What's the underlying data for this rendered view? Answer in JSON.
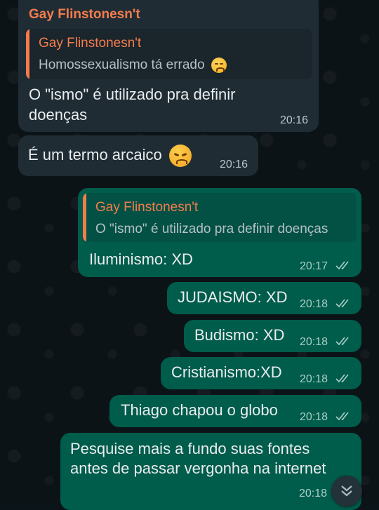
{
  "messages": [
    {
      "sender": "Gay Flinstonesn't",
      "quote": {
        "name": "Gay Flinstonesn't",
        "text": "Homossexualismo tá errado"
      },
      "lines": [
        "O \"ismo\" é utilizado pra definir",
        "doenças"
      ],
      "time": "20:16"
    },
    {
      "text": "É um termo arcaico",
      "time": "20:16"
    },
    {
      "quote": {
        "name": "Gay Flinstonesn't",
        "text": "O \"ismo\" é utilizado pra definir doenças"
      },
      "text": "Iluminismo: XD",
      "time": "20:17"
    },
    {
      "text": "JUDAISMO: XD",
      "time": "20:18"
    },
    {
      "text": "Budismo: XD",
      "time": "20:18"
    },
    {
      "text": "Cristianismo:XD",
      "time": "20:18"
    },
    {
      "text": "Thiago chapou o globo",
      "time": "20:18"
    },
    {
      "lines": [
        "Pesquise mais a fundo suas fontes",
        "antes de passar vergonha na internet"
      ],
      "time": "20:18"
    }
  ],
  "colors": {
    "incoming": "#1f2c34",
    "outgoing": "#005c4b",
    "sender_name": "#f57c4c",
    "read_ticks": "#a9cfc6"
  },
  "icons": {
    "emoji_reaction": "unamused-face-emoji",
    "emoji_inline": "angry-face-emoji",
    "read_receipt": "double-check-icon",
    "scroll": "chevron-double-down-icon"
  }
}
